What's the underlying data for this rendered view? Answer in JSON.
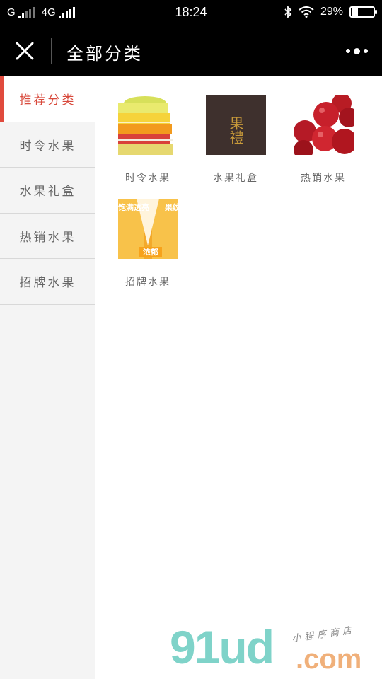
{
  "status_bar": {
    "carrier_left": "G",
    "network": "4G",
    "time": "18:24",
    "battery_text": "29%",
    "battery_level": 0.29
  },
  "nav": {
    "title": "全部分类"
  },
  "sidebar": {
    "items": [
      {
        "label": "推荐分类",
        "active": true
      },
      {
        "label": "时令水果",
        "active": false
      },
      {
        "label": "水果礼盒",
        "active": false
      },
      {
        "label": "热销水果",
        "active": false
      },
      {
        "label": "招牌水果",
        "active": false
      }
    ]
  },
  "grid": {
    "items": [
      {
        "label": "时令水果",
        "icon": "sliced-fruit-stack-image"
      },
      {
        "label": "水果礼盒",
        "icon": "fruit-gift-box-image",
        "image_text": "果禮"
      },
      {
        "label": "热销水果",
        "icon": "red-apples-image"
      },
      {
        "label": "招牌水果",
        "icon": "orange-fruit-poster-image",
        "image_text_1": "饱满透亮",
        "image_text_2": "浓郁",
        "image_text_3": "果纹"
      }
    ]
  },
  "watermark": {
    "brand": "91ud",
    "domain": ".com",
    "tagline": "小程序商店"
  },
  "colors": {
    "accent": "#e04a3d",
    "sidebar_bg": "#f4f4f4",
    "bar_bg": "#000000"
  }
}
